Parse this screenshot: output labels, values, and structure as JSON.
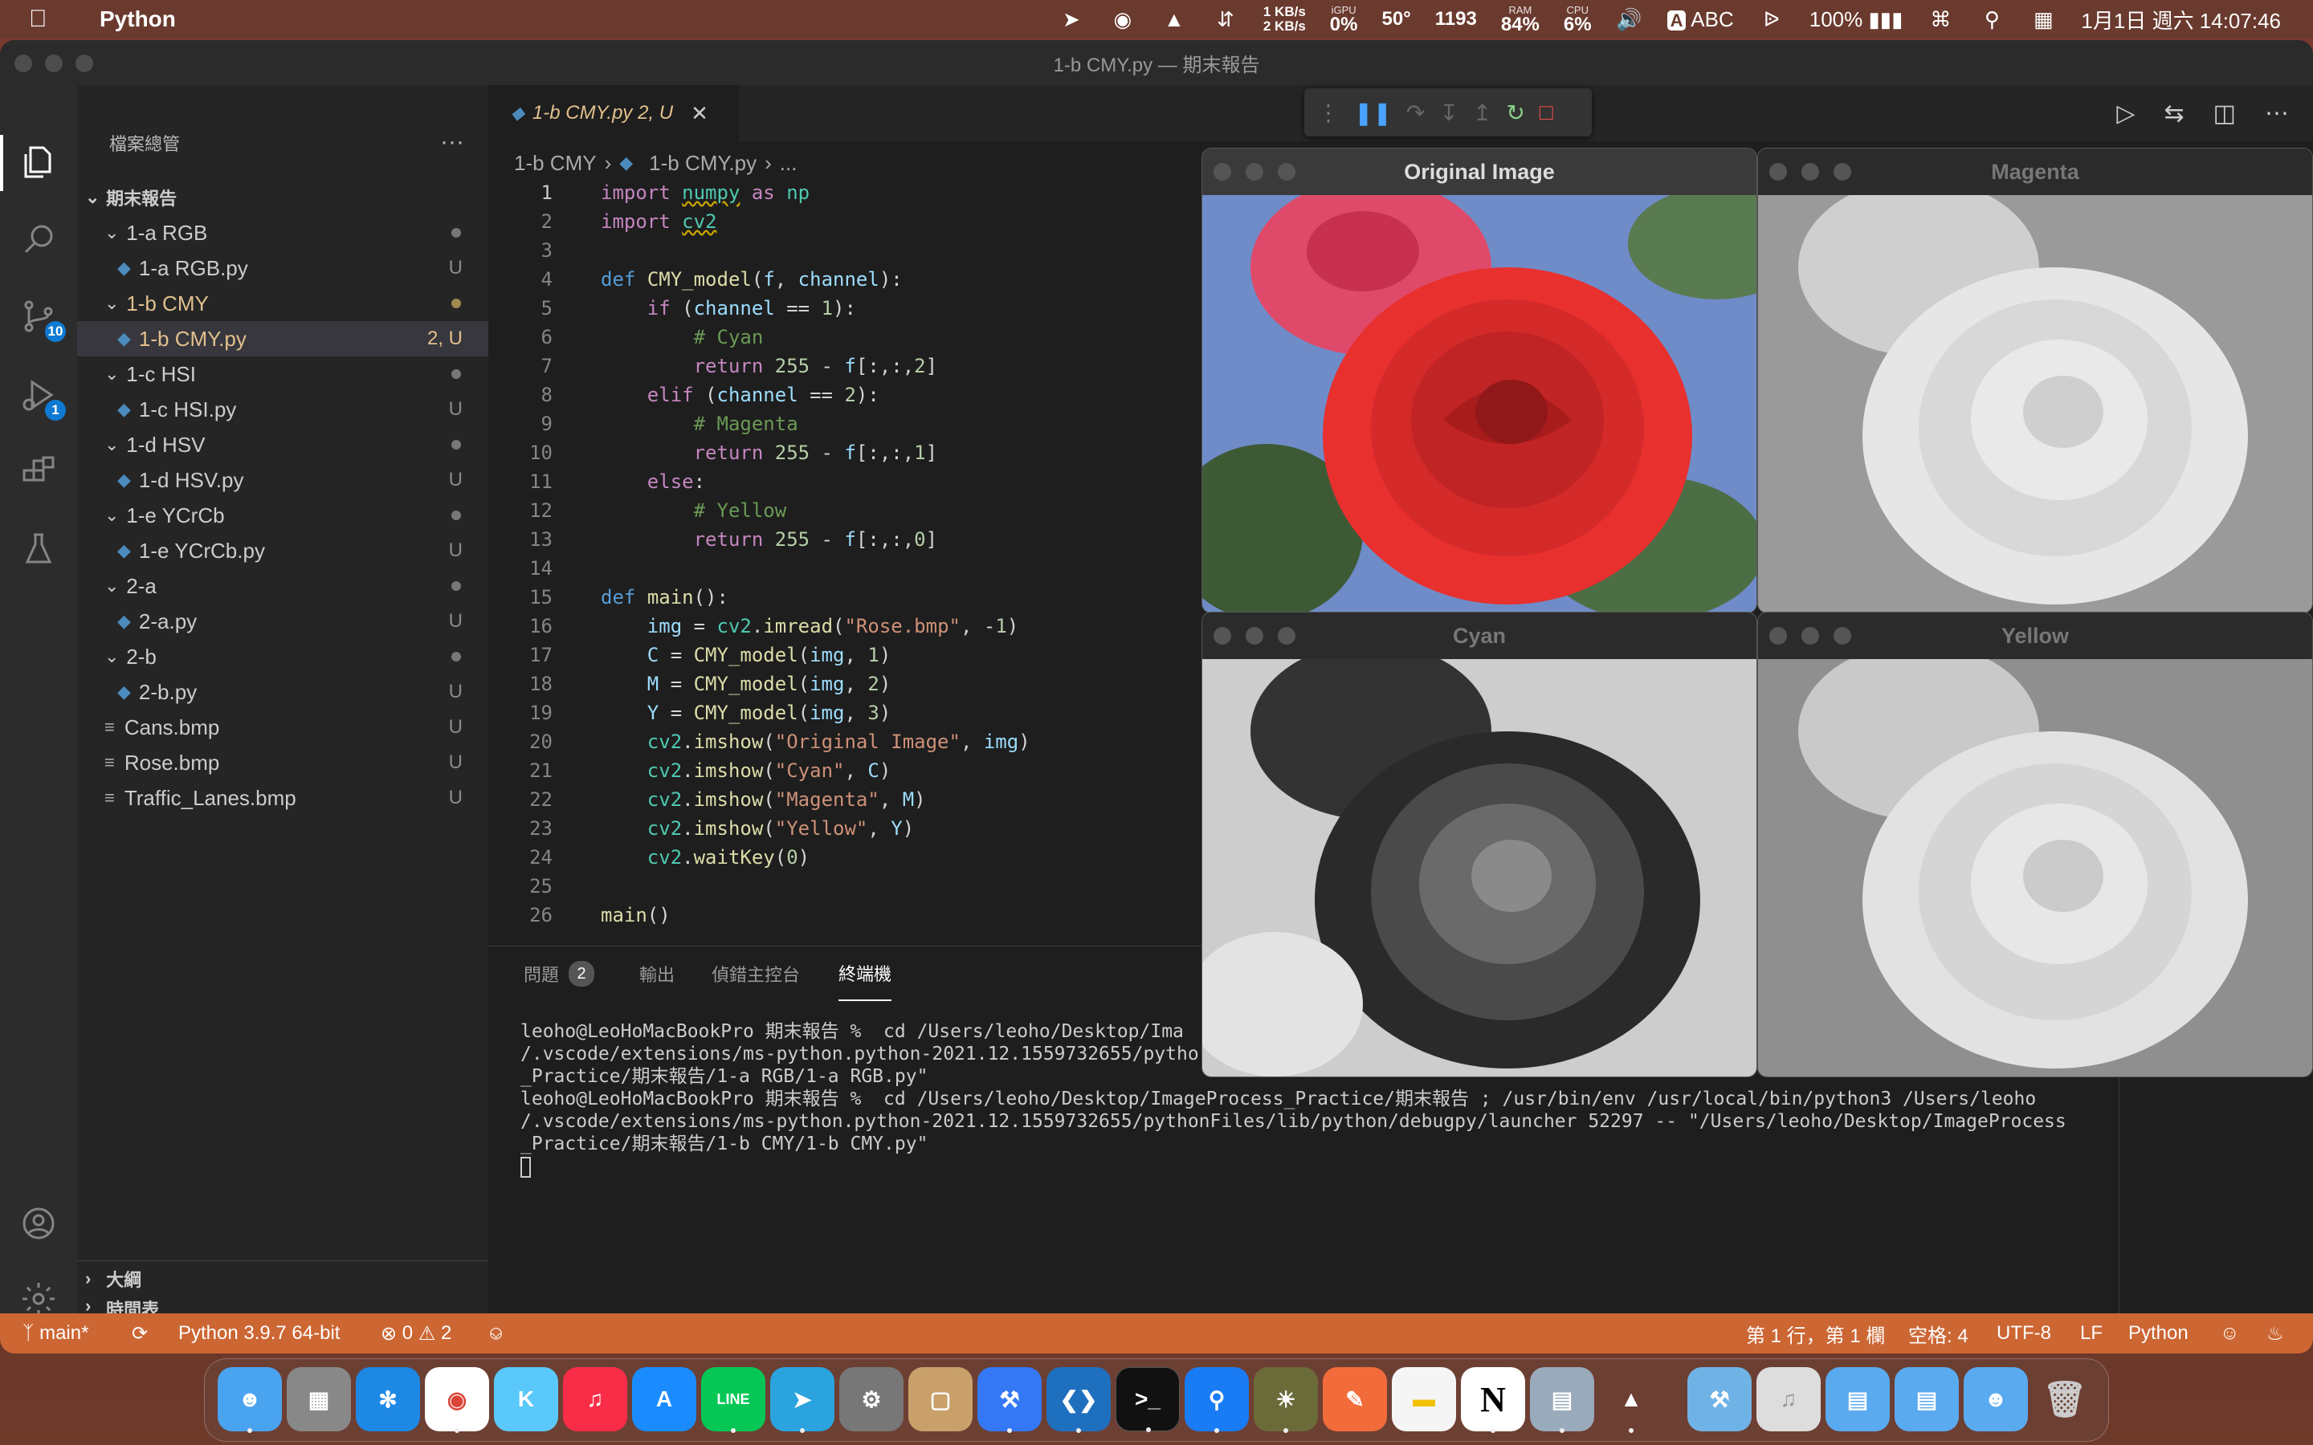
{
  "menubar": {
    "app_name": "Python",
    "net_up": "1 KB/s",
    "net_down": "2 KB/s",
    "igpu_label": "iGPU",
    "igpu_value": "0%",
    "temp": "50°",
    "fan": "1193",
    "ram_label": "RAM",
    "ram_value": "84%",
    "cpu_label": "CPU",
    "cpu_value": "6%",
    "input_source": "ABC",
    "input_badge": "A",
    "battery": "100%",
    "datetime": "1月1日 週六  14:07:46"
  },
  "window": {
    "title": "1-b CMY.py — 期末報告"
  },
  "activity": {
    "scm_badge": "10",
    "debug_badge": "1"
  },
  "sidebar": {
    "header": "檔案總管",
    "more": "···",
    "root": "期末報告",
    "items": [
      {
        "label": "1-a RGB",
        "badge": ""
      },
      {
        "label": "1-a RGB.py",
        "badge": "U"
      },
      {
        "label": "1-b CMY",
        "badge": ""
      },
      {
        "label": "1-b CMY.py",
        "badge": "2, U"
      },
      {
        "label": "1-c HSI",
        "badge": ""
      },
      {
        "label": "1-c HSI.py",
        "badge": "U"
      },
      {
        "label": "1-d HSV",
        "badge": ""
      },
      {
        "label": "1-d HSV.py",
        "badge": "U"
      },
      {
        "label": "1-e YCrCb",
        "badge": ""
      },
      {
        "label": "1-e YCrCb.py",
        "badge": "U"
      },
      {
        "label": "2-a",
        "badge": ""
      },
      {
        "label": "2-a.py",
        "badge": "U"
      },
      {
        "label": "2-b",
        "badge": ""
      },
      {
        "label": "2-b.py",
        "badge": "U"
      },
      {
        "label": "Cans.bmp",
        "badge": "U"
      },
      {
        "label": "Rose.bmp",
        "badge": "U"
      },
      {
        "label": "Traffic_Lanes.bmp",
        "badge": "U"
      }
    ],
    "outline": "大綱",
    "timeline": "時間表"
  },
  "editor": {
    "tab_label": "1-b CMY.py",
    "tab_badge": "2, U",
    "breadcrumb": [
      "1-b CMY",
      "1-b CMY.py",
      "..."
    ],
    "lines": [
      "1",
      "2",
      "3",
      "4",
      "5",
      "6",
      "7",
      "8",
      "9",
      "10",
      "11",
      "12",
      "13",
      "14",
      "15",
      "16",
      "17",
      "18",
      "19",
      "20",
      "21",
      "22",
      "23",
      "24",
      "25",
      "26"
    ]
  },
  "panel": {
    "tabs": [
      "問題",
      "輸出",
      "偵錯主控台",
      "終端機"
    ],
    "problems_count": "2",
    "terminal_lines": [
      "leoho@LeoHoMacBookPro 期末報告 %  cd /Users/leoho/Desktop/Ima",
      "/.vscode/extensions/ms-python.python-2021.12.1559732655/pytho",
      "_Practice/期末報告/1-a RGB/1-a RGB.py\"",
      "leoho@LeoHoMacBookPro 期末報告 %  cd /Users/leoho/Desktop/ImageProcess_Practice/期末報告 ; /usr/bin/env /usr/local/bin/python3 /Users/leoho",
      "/.vscode/extensions/ms-python.python-2021.12.1559732655/pythonFiles/lib/python/debugpy/launcher 52297 -- \"/Users/leoho/Desktop/ImageProcess",
      "_Practice/期末報告/1-b CMY/1-b CMY.py\""
    ]
  },
  "statusbar": {
    "branch": "main*",
    "interpreter": "Python 3.9.7 64-bit",
    "errors": "0",
    "warnings": "2",
    "cursor_pos": "第 1 行，第 1 欄",
    "indent": "空格: 4",
    "encoding": "UTF-8",
    "eol": "LF",
    "language": "Python"
  },
  "image_windows": {
    "original": "Original Image",
    "magenta": "Magenta",
    "cyan": "Cyan",
    "yellow": "Yellow"
  },
  "dock": {
    "line_label": "LINE"
  }
}
